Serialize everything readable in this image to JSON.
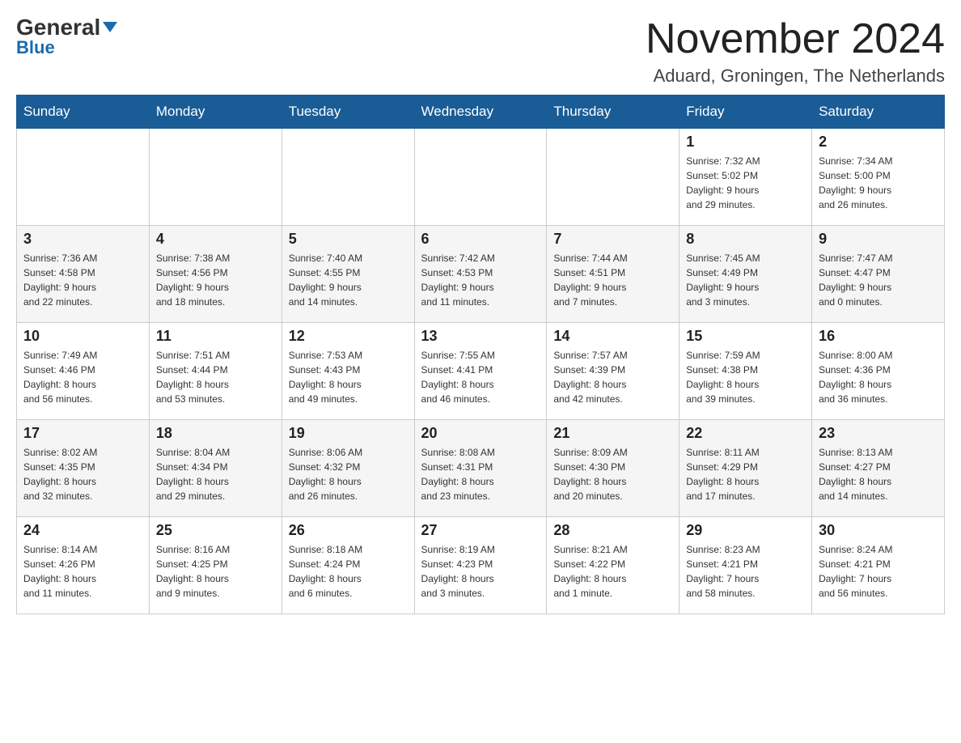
{
  "logo": {
    "general": "General",
    "blue": "Blue"
  },
  "header": {
    "title": "November 2024",
    "subtitle": "Aduard, Groningen, The Netherlands"
  },
  "days_of_week": [
    "Sunday",
    "Monday",
    "Tuesday",
    "Wednesday",
    "Thursday",
    "Friday",
    "Saturday"
  ],
  "weeks": [
    {
      "days": [
        {
          "number": "",
          "info": ""
        },
        {
          "number": "",
          "info": ""
        },
        {
          "number": "",
          "info": ""
        },
        {
          "number": "",
          "info": ""
        },
        {
          "number": "",
          "info": ""
        },
        {
          "number": "1",
          "info": "Sunrise: 7:32 AM\nSunset: 5:02 PM\nDaylight: 9 hours\nand 29 minutes."
        },
        {
          "number": "2",
          "info": "Sunrise: 7:34 AM\nSunset: 5:00 PM\nDaylight: 9 hours\nand 26 minutes."
        }
      ]
    },
    {
      "days": [
        {
          "number": "3",
          "info": "Sunrise: 7:36 AM\nSunset: 4:58 PM\nDaylight: 9 hours\nand 22 minutes."
        },
        {
          "number": "4",
          "info": "Sunrise: 7:38 AM\nSunset: 4:56 PM\nDaylight: 9 hours\nand 18 minutes."
        },
        {
          "number": "5",
          "info": "Sunrise: 7:40 AM\nSunset: 4:55 PM\nDaylight: 9 hours\nand 14 minutes."
        },
        {
          "number": "6",
          "info": "Sunrise: 7:42 AM\nSunset: 4:53 PM\nDaylight: 9 hours\nand 11 minutes."
        },
        {
          "number": "7",
          "info": "Sunrise: 7:44 AM\nSunset: 4:51 PM\nDaylight: 9 hours\nand 7 minutes."
        },
        {
          "number": "8",
          "info": "Sunrise: 7:45 AM\nSunset: 4:49 PM\nDaylight: 9 hours\nand 3 minutes."
        },
        {
          "number": "9",
          "info": "Sunrise: 7:47 AM\nSunset: 4:47 PM\nDaylight: 9 hours\nand 0 minutes."
        }
      ]
    },
    {
      "days": [
        {
          "number": "10",
          "info": "Sunrise: 7:49 AM\nSunset: 4:46 PM\nDaylight: 8 hours\nand 56 minutes."
        },
        {
          "number": "11",
          "info": "Sunrise: 7:51 AM\nSunset: 4:44 PM\nDaylight: 8 hours\nand 53 minutes."
        },
        {
          "number": "12",
          "info": "Sunrise: 7:53 AM\nSunset: 4:43 PM\nDaylight: 8 hours\nand 49 minutes."
        },
        {
          "number": "13",
          "info": "Sunrise: 7:55 AM\nSunset: 4:41 PM\nDaylight: 8 hours\nand 46 minutes."
        },
        {
          "number": "14",
          "info": "Sunrise: 7:57 AM\nSunset: 4:39 PM\nDaylight: 8 hours\nand 42 minutes."
        },
        {
          "number": "15",
          "info": "Sunrise: 7:59 AM\nSunset: 4:38 PM\nDaylight: 8 hours\nand 39 minutes."
        },
        {
          "number": "16",
          "info": "Sunrise: 8:00 AM\nSunset: 4:36 PM\nDaylight: 8 hours\nand 36 minutes."
        }
      ]
    },
    {
      "days": [
        {
          "number": "17",
          "info": "Sunrise: 8:02 AM\nSunset: 4:35 PM\nDaylight: 8 hours\nand 32 minutes."
        },
        {
          "number": "18",
          "info": "Sunrise: 8:04 AM\nSunset: 4:34 PM\nDaylight: 8 hours\nand 29 minutes."
        },
        {
          "number": "19",
          "info": "Sunrise: 8:06 AM\nSunset: 4:32 PM\nDaylight: 8 hours\nand 26 minutes."
        },
        {
          "number": "20",
          "info": "Sunrise: 8:08 AM\nSunset: 4:31 PM\nDaylight: 8 hours\nand 23 minutes."
        },
        {
          "number": "21",
          "info": "Sunrise: 8:09 AM\nSunset: 4:30 PM\nDaylight: 8 hours\nand 20 minutes."
        },
        {
          "number": "22",
          "info": "Sunrise: 8:11 AM\nSunset: 4:29 PM\nDaylight: 8 hours\nand 17 minutes."
        },
        {
          "number": "23",
          "info": "Sunrise: 8:13 AM\nSunset: 4:27 PM\nDaylight: 8 hours\nand 14 minutes."
        }
      ]
    },
    {
      "days": [
        {
          "number": "24",
          "info": "Sunrise: 8:14 AM\nSunset: 4:26 PM\nDaylight: 8 hours\nand 11 minutes."
        },
        {
          "number": "25",
          "info": "Sunrise: 8:16 AM\nSunset: 4:25 PM\nDaylight: 8 hours\nand 9 minutes."
        },
        {
          "number": "26",
          "info": "Sunrise: 8:18 AM\nSunset: 4:24 PM\nDaylight: 8 hours\nand 6 minutes."
        },
        {
          "number": "27",
          "info": "Sunrise: 8:19 AM\nSunset: 4:23 PM\nDaylight: 8 hours\nand 3 minutes."
        },
        {
          "number": "28",
          "info": "Sunrise: 8:21 AM\nSunset: 4:22 PM\nDaylight: 8 hours\nand 1 minute."
        },
        {
          "number": "29",
          "info": "Sunrise: 8:23 AM\nSunset: 4:21 PM\nDaylight: 7 hours\nand 58 minutes."
        },
        {
          "number": "30",
          "info": "Sunrise: 8:24 AM\nSunset: 4:21 PM\nDaylight: 7 hours\nand 56 minutes."
        }
      ]
    }
  ]
}
